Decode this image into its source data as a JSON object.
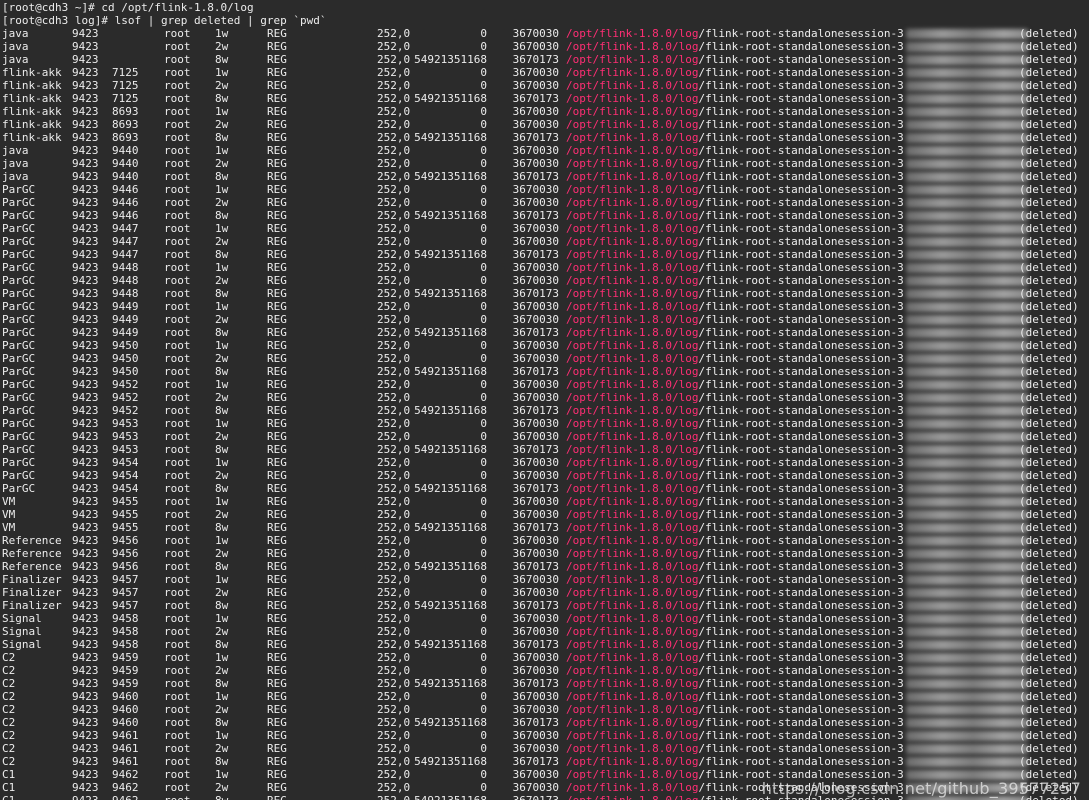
{
  "terminal": {
    "prompt_lines": [
      "[root@cdh3 ~]# cd /opt/flink-1.8.0/log",
      "[root@cdh3 log]# lsof | grep deleted | grep `pwd`"
    ],
    "user": "root",
    "type": "REG",
    "device": "252,0",
    "path_highlight": "/opt/flink-1.8.0/log",
    "path_rest": "/flink-root-standalonesession-3",
    "deleted_label": "(deleted)",
    "rows": [
      {
        "cmd": "java",
        "pid": "9423",
        "tid": "",
        "fd": "1w",
        "size": "0",
        "node": "3670030"
      },
      {
        "cmd": "java",
        "pid": "9423",
        "tid": "",
        "fd": "2w",
        "size": "0",
        "node": "3670030"
      },
      {
        "cmd": "java",
        "pid": "9423",
        "tid": "",
        "fd": "8w",
        "size": "54921351168",
        "node": "3670173"
      },
      {
        "cmd": "flink-akk",
        "pid": "9423",
        "tid": "7125",
        "fd": "1w",
        "size": "0",
        "node": "3670030"
      },
      {
        "cmd": "flink-akk",
        "pid": "9423",
        "tid": "7125",
        "fd": "2w",
        "size": "0",
        "node": "3670030"
      },
      {
        "cmd": "flink-akk",
        "pid": "9423",
        "tid": "7125",
        "fd": "8w",
        "size": "54921351168",
        "node": "3670173"
      },
      {
        "cmd": "flink-akk",
        "pid": "9423",
        "tid": "8693",
        "fd": "1w",
        "size": "0",
        "node": "3670030"
      },
      {
        "cmd": "flink-akk",
        "pid": "9423",
        "tid": "8693",
        "fd": "2w",
        "size": "0",
        "node": "3670030"
      },
      {
        "cmd": "flink-akk",
        "pid": "9423",
        "tid": "8693",
        "fd": "8w",
        "size": "54921351168",
        "node": "3670173"
      },
      {
        "cmd": "java",
        "pid": "9423",
        "tid": "9440",
        "fd": "1w",
        "size": "0",
        "node": "3670030"
      },
      {
        "cmd": "java",
        "pid": "9423",
        "tid": "9440",
        "fd": "2w",
        "size": "0",
        "node": "3670030"
      },
      {
        "cmd": "java",
        "pid": "9423",
        "tid": "9440",
        "fd": "8w",
        "size": "54921351168",
        "node": "3670173"
      },
      {
        "cmd": "ParGC",
        "pid": "9423",
        "tid": "9446",
        "fd": "1w",
        "size": "0",
        "node": "3670030"
      },
      {
        "cmd": "ParGC",
        "pid": "9423",
        "tid": "9446",
        "fd": "2w",
        "size": "0",
        "node": "3670030"
      },
      {
        "cmd": "ParGC",
        "pid": "9423",
        "tid": "9446",
        "fd": "8w",
        "size": "54921351168",
        "node": "3670173"
      },
      {
        "cmd": "ParGC",
        "pid": "9423",
        "tid": "9447",
        "fd": "1w",
        "size": "0",
        "node": "3670030"
      },
      {
        "cmd": "ParGC",
        "pid": "9423",
        "tid": "9447",
        "fd": "2w",
        "size": "0",
        "node": "3670030"
      },
      {
        "cmd": "ParGC",
        "pid": "9423",
        "tid": "9447",
        "fd": "8w",
        "size": "54921351168",
        "node": "3670173"
      },
      {
        "cmd": "ParGC",
        "pid": "9423",
        "tid": "9448",
        "fd": "1w",
        "size": "0",
        "node": "3670030"
      },
      {
        "cmd": "ParGC",
        "pid": "9423",
        "tid": "9448",
        "fd": "2w",
        "size": "0",
        "node": "3670030"
      },
      {
        "cmd": "ParGC",
        "pid": "9423",
        "tid": "9448",
        "fd": "8w",
        "size": "54921351168",
        "node": "3670173"
      },
      {
        "cmd": "ParGC",
        "pid": "9423",
        "tid": "9449",
        "fd": "1w",
        "size": "0",
        "node": "3670030"
      },
      {
        "cmd": "ParGC",
        "pid": "9423",
        "tid": "9449",
        "fd": "2w",
        "size": "0",
        "node": "3670030"
      },
      {
        "cmd": "ParGC",
        "pid": "9423",
        "tid": "9449",
        "fd": "8w",
        "size": "54921351168",
        "node": "3670173"
      },
      {
        "cmd": "ParGC",
        "pid": "9423",
        "tid": "9450",
        "fd": "1w",
        "size": "0",
        "node": "3670030"
      },
      {
        "cmd": "ParGC",
        "pid": "9423",
        "tid": "9450",
        "fd": "2w",
        "size": "0",
        "node": "3670030"
      },
      {
        "cmd": "ParGC",
        "pid": "9423",
        "tid": "9450",
        "fd": "8w",
        "size": "54921351168",
        "node": "3670173"
      },
      {
        "cmd": "ParGC",
        "pid": "9423",
        "tid": "9452",
        "fd": "1w",
        "size": "0",
        "node": "3670030"
      },
      {
        "cmd": "ParGC",
        "pid": "9423",
        "tid": "9452",
        "fd": "2w",
        "size": "0",
        "node": "3670030"
      },
      {
        "cmd": "ParGC",
        "pid": "9423",
        "tid": "9452",
        "fd": "8w",
        "size": "54921351168",
        "node": "3670173"
      },
      {
        "cmd": "ParGC",
        "pid": "9423",
        "tid": "9453",
        "fd": "1w",
        "size": "0",
        "node": "3670030"
      },
      {
        "cmd": "ParGC",
        "pid": "9423",
        "tid": "9453",
        "fd": "2w",
        "size": "0",
        "node": "3670030"
      },
      {
        "cmd": "ParGC",
        "pid": "9423",
        "tid": "9453",
        "fd": "8w",
        "size": "54921351168",
        "node": "3670173"
      },
      {
        "cmd": "ParGC",
        "pid": "9423",
        "tid": "9454",
        "fd": "1w",
        "size": "0",
        "node": "3670030"
      },
      {
        "cmd": "ParGC",
        "pid": "9423",
        "tid": "9454",
        "fd": "2w",
        "size": "0",
        "node": "3670030"
      },
      {
        "cmd": "ParGC",
        "pid": "9423",
        "tid": "9454",
        "fd": "8w",
        "size": "54921351168",
        "node": "3670173"
      },
      {
        "cmd": "VM",
        "pid": "9423",
        "tid": "9455",
        "fd": "1w",
        "size": "0",
        "node": "3670030"
      },
      {
        "cmd": "VM",
        "pid": "9423",
        "tid": "9455",
        "fd": "2w",
        "size": "0",
        "node": "3670030"
      },
      {
        "cmd": "VM",
        "pid": "9423",
        "tid": "9455",
        "fd": "8w",
        "size": "54921351168",
        "node": "3670173"
      },
      {
        "cmd": "Reference",
        "pid": "9423",
        "tid": "9456",
        "fd": "1w",
        "size": "0",
        "node": "3670030"
      },
      {
        "cmd": "Reference",
        "pid": "9423",
        "tid": "9456",
        "fd": "2w",
        "size": "0",
        "node": "3670030"
      },
      {
        "cmd": "Reference",
        "pid": "9423",
        "tid": "9456",
        "fd": "8w",
        "size": "54921351168",
        "node": "3670173"
      },
      {
        "cmd": "Finalizer",
        "pid": "9423",
        "tid": "9457",
        "fd": "1w",
        "size": "0",
        "node": "3670030"
      },
      {
        "cmd": "Finalizer",
        "pid": "9423",
        "tid": "9457",
        "fd": "2w",
        "size": "0",
        "node": "3670030"
      },
      {
        "cmd": "Finalizer",
        "pid": "9423",
        "tid": "9457",
        "fd": "8w",
        "size": "54921351168",
        "node": "3670173"
      },
      {
        "cmd": "Signal",
        "pid": "9423",
        "tid": "9458",
        "fd": "1w",
        "size": "0",
        "node": "3670030"
      },
      {
        "cmd": "Signal",
        "pid": "9423",
        "tid": "9458",
        "fd": "2w",
        "size": "0",
        "node": "3670030"
      },
      {
        "cmd": "Signal",
        "pid": "9423",
        "tid": "9458",
        "fd": "8w",
        "size": "54921351168",
        "node": "3670173"
      },
      {
        "cmd": "C2",
        "pid": "9423",
        "tid": "9459",
        "fd": "1w",
        "size": "0",
        "node": "3670030"
      },
      {
        "cmd": "C2",
        "pid": "9423",
        "tid": "9459",
        "fd": "2w",
        "size": "0",
        "node": "3670030"
      },
      {
        "cmd": "C2",
        "pid": "9423",
        "tid": "9459",
        "fd": "8w",
        "size": "54921351168",
        "node": "3670173"
      },
      {
        "cmd": "C2",
        "pid": "9423",
        "tid": "9460",
        "fd": "1w",
        "size": "0",
        "node": "3670030"
      },
      {
        "cmd": "C2",
        "pid": "9423",
        "tid": "9460",
        "fd": "2w",
        "size": "0",
        "node": "3670030"
      },
      {
        "cmd": "C2",
        "pid": "9423",
        "tid": "9460",
        "fd": "8w",
        "size": "54921351168",
        "node": "3670173"
      },
      {
        "cmd": "C2",
        "pid": "9423",
        "tid": "9461",
        "fd": "1w",
        "size": "0",
        "node": "3670030"
      },
      {
        "cmd": "C2",
        "pid": "9423",
        "tid": "9461",
        "fd": "2w",
        "size": "0",
        "node": "3670030"
      },
      {
        "cmd": "C2",
        "pid": "9423",
        "tid": "9461",
        "fd": "8w",
        "size": "54921351168",
        "node": "3670173"
      },
      {
        "cmd": "C1",
        "pid": "9423",
        "tid": "9462",
        "fd": "1w",
        "size": "0",
        "node": "3670030"
      },
      {
        "cmd": "C1",
        "pid": "9423",
        "tid": "9462",
        "fd": "2w",
        "size": "0",
        "node": "3670030"
      },
      {
        "cmd": "C1",
        "pid": "9423",
        "tid": "9462",
        "fd": "8w",
        "size": "54921351168",
        "node": "3670173"
      }
    ]
  },
  "watermark": "https://blog.csdn.net/github_39577257",
  "colors": {
    "background": "#2b2b2b",
    "text": "#ececec",
    "path_highlight": "#ff2e74"
  }
}
